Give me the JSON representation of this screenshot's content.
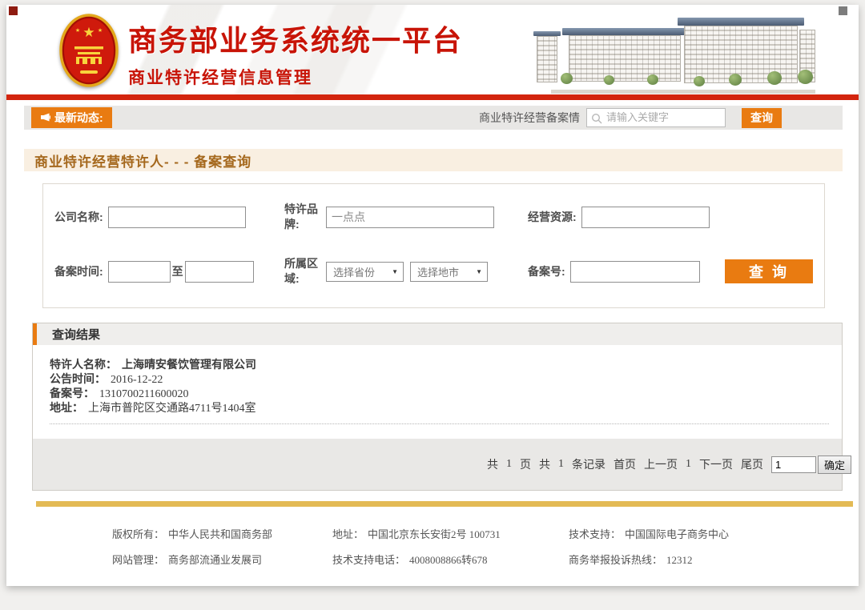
{
  "header": {
    "title": "商务部业务系统统一平台",
    "subtitle": "商业特许经营信息管理"
  },
  "newsbar": {
    "badge_label": "最新动态:",
    "search_label": "商业特许经营备案情",
    "search_placeholder": "请输入关键字",
    "search_button_label": "查询"
  },
  "section": {
    "title": "商业特许经营特许人- - - 备案查询"
  },
  "form": {
    "company_label": "公司名称:",
    "brand_label": "特许品牌:",
    "brand_value": "一点点",
    "resource_label": "经营资源:",
    "time_label": "备案时间:",
    "to_label": "至",
    "region_label": "所属区域:",
    "province_placeholder": "选择省份",
    "city_placeholder": "选择地市",
    "select_arrow": "▼",
    "filing_label": "备案号:",
    "query_button_label": "查 询"
  },
  "results": {
    "title": "查询结果",
    "record": {
      "name_label": "特许人名称：",
      "name_value": "上海晴安餐饮管理有限公司",
      "date_label": "公告时间：",
      "date_value": "2016-12-22",
      "filing_label": "备案号：",
      "filing_value": "1310700211600020",
      "address_label": "地址：",
      "address_value": "上海市普陀区交通路4711号1404室"
    },
    "pagination": {
      "total_prefix": "共",
      "page_count": "1",
      "page_unit": "页",
      "record_prefix": "共",
      "record_count": "1",
      "record_unit": "条记录",
      "first": "首页",
      "prev": "上一页",
      "current": "1",
      "next": "下一页",
      "last": "尾页",
      "goto_value": "1",
      "confirm_label": "确定"
    }
  },
  "footer": {
    "copyright_label": "版权所有：",
    "copyright_value": "中华人民共和国商务部",
    "sitemgmt_label": "网站管理：",
    "sitemgmt_value": "商务部流通业发展司",
    "address_label": "地址：",
    "address_value": "中国北京东长安街2号 100731",
    "phone_label": "技术支持电话：",
    "phone_value": "4008008866转678",
    "support_label": "技术支持：",
    "support_value": "中国国际电子商务中心",
    "hotline_label": "商务举报投诉热线：",
    "hotline_value": "12312"
  },
  "colors": {
    "brand_red": "#c81407",
    "accent_orange": "#e97b11",
    "gold_bar": "#e3ba55"
  }
}
